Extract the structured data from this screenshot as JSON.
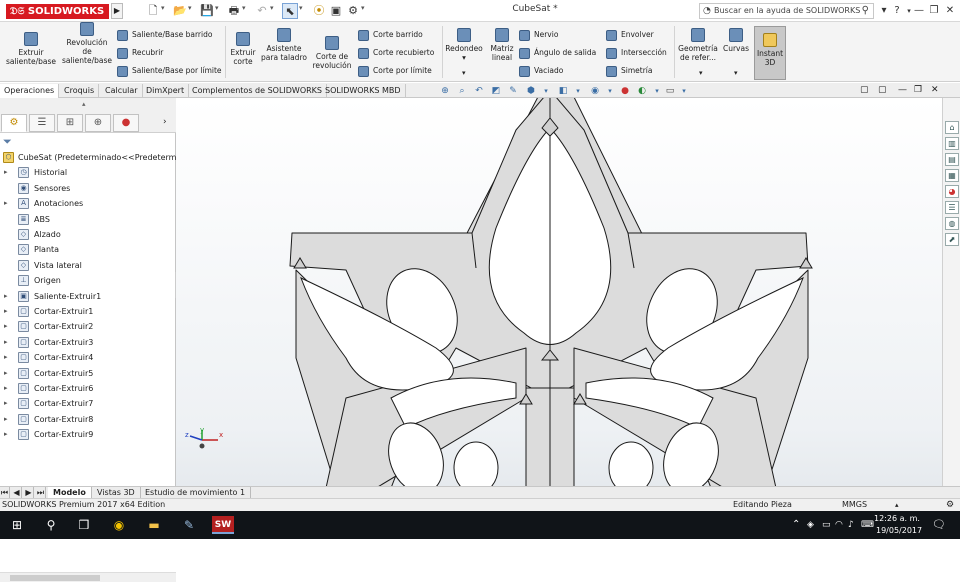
{
  "app": {
    "logo_text": "SOLIDWORKS",
    "document_title": "CubeSat *",
    "help_search_placeholder": "Buscar en la ayuda de SOLIDWORKS",
    "help_icon": "question-icon"
  },
  "ribbon": {
    "buttons": [
      {
        "id": "extruir",
        "label1": "Extruir",
        "label2": "saliente/base",
        "label3": ""
      },
      {
        "id": "revolucion",
        "label1": "Revolución",
        "label2": "de",
        "label3": "saliente/base"
      },
      {
        "id": "extruir-corte",
        "label1": "Extruir",
        "label2": "corte",
        "label3": ""
      },
      {
        "id": "asistente",
        "label1": "Asistente",
        "label2": "para taladro",
        "label3": ""
      },
      {
        "id": "corte-revolucion",
        "label1": "Corte de",
        "label2": "revolución",
        "label3": ""
      },
      {
        "id": "redondeo",
        "label1": "Redondeo",
        "label2": "",
        "label3": ""
      },
      {
        "id": "matriz",
        "label1": "Matriz",
        "label2": "lineal",
        "label3": ""
      },
      {
        "id": "geometria",
        "label1": "Geometría",
        "label2": "de refer...",
        "label3": ""
      },
      {
        "id": "curvas",
        "label1": "Curvas",
        "label2": "",
        "label3": ""
      },
      {
        "id": "instant3d",
        "label1": "Instant",
        "label2": "3D",
        "label3": ""
      }
    ],
    "small_a": [
      "Saliente/Base barrido",
      "Recubrir",
      "Saliente/Base por límite"
    ],
    "small_b": [
      "Corte barrido",
      "Corte recubierto",
      "Corte por límite"
    ],
    "small_c": [
      "Nervio",
      "Ángulo de salida",
      "Vaciado"
    ],
    "small_d": [
      "Envolver",
      "Intersección",
      "Simetría"
    ]
  },
  "command_tabs": [
    "Operaciones",
    "Croquis",
    "Calcular",
    "DimXpert",
    "Complementos de SOLIDWORKS",
    "SOLIDWORKS MBD"
  ],
  "feature_tree": {
    "root": "CubeSat  (Predeterminado<<Predeterminado",
    "items": [
      "Historial",
      "Sensores",
      "Anotaciones",
      "ABS",
      "Alzado",
      "Planta",
      "Vista lateral",
      "Origen",
      "Saliente-Extruir1",
      "Cortar-Extruir1",
      "Cortar-Extruir2",
      "Cortar-Extruir3",
      "Cortar-Extruir4",
      "Cortar-Extruir5",
      "Cortar-Extruir6",
      "Cortar-Extruir7",
      "Cortar-Extruir8",
      "Cortar-Extruir9"
    ]
  },
  "triad": {
    "x": "x",
    "y": "y",
    "z": "z"
  },
  "bottom_tabs": [
    "Modelo",
    "Vistas 3D",
    "Estudio de movimiento 1"
  ],
  "status": {
    "left": "SOLIDWORKS Premium 2017 x64 Edition",
    "mode": "Editando Pieza",
    "units": "MMGS"
  },
  "taskbar": {
    "time": "12:26 a. m.",
    "date": "19/05/2017"
  },
  "colors": {
    "brand": "#d71920",
    "part_fill": "#dcdcdc",
    "part_edge": "#1a1a1a",
    "taskbar": "#101418"
  }
}
